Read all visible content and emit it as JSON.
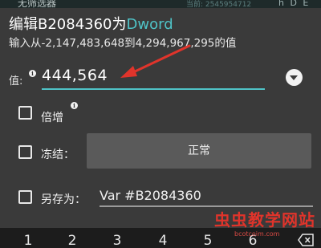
{
  "background": {
    "left_text": "无筛选器",
    "mid_text": "当前: 2545954712",
    "right_text": "h D E"
  },
  "dialog": {
    "title_prefix": "编辑B2084360为",
    "title_type": "Dword",
    "range_hint": "输入从-2,147,483,648到4,294,967,295的值",
    "value_label": "值:",
    "value": "444,564",
    "multiply_label": "倍增",
    "freeze_label": "冻结：",
    "freeze_mode": "正常",
    "save_as_label": "另存为：",
    "save_as_value": "Var #B2084360"
  },
  "keyboard": {
    "keys": [
      "1",
      "2",
      "3",
      "4",
      "5",
      "6"
    ],
    "delete_icon": "backspace-icon"
  },
  "watermark": {
    "title": "虫虫教学网站",
    "url": "bcotcoim.com"
  },
  "colors": {
    "accent": "#4fc3c7",
    "dialog_bg": "#3a3a3a",
    "button_bg": "#5a5a5a",
    "annotation_arrow": "#e0342b"
  }
}
